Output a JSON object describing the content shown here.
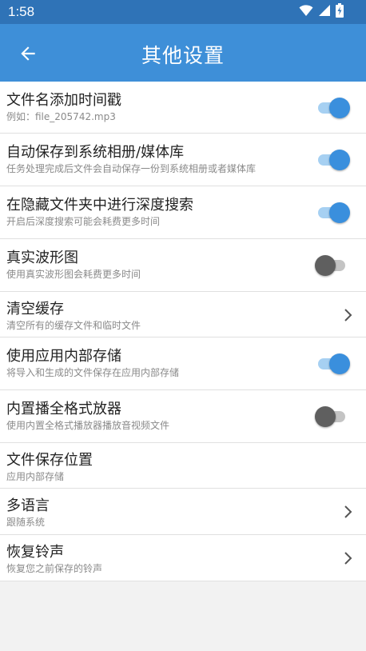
{
  "status_bar": {
    "time": "1:58",
    "icons": [
      "wifi-icon",
      "signal-icon",
      "battery-charging-icon"
    ]
  },
  "header": {
    "title": "其他设置",
    "back_icon": "arrow-left-icon"
  },
  "colors": {
    "header": "#3e8fd8",
    "status_bar": "#2f73b7",
    "toggle_on": "#3a8fdd",
    "toggle_off": "#5f5f5f"
  },
  "settings": [
    {
      "title": "文件名添加时间戳",
      "subtitle": "例如：file_205742.mp3",
      "control": "toggle",
      "on": true
    },
    {
      "title": "自动保存到系统相册/媒体库",
      "subtitle": "任务处理完成后文件会自动保存一份到系统相册或者媒体库",
      "control": "toggle",
      "on": true
    },
    {
      "title": "在隐藏文件夹中进行深度搜索",
      "subtitle": "开启后深度搜索可能会耗费更多时间",
      "control": "toggle",
      "on": true
    },
    {
      "title": "真实波形图",
      "subtitle": "使用真实波形图会耗费更多时间",
      "control": "toggle",
      "on": false
    },
    {
      "title": "清空缓存",
      "subtitle": "清空所有的缓存文件和临时文件",
      "control": "chevron"
    },
    {
      "title": "使用应用内部存储",
      "subtitle": "将导入和生成的文件保存在应用内部存储",
      "control": "toggle",
      "on": true
    },
    {
      "title": "内置播全格式放器",
      "subtitle": "使用内置全格式播放器播放音视频文件",
      "control": "toggle",
      "on": false
    },
    {
      "title": "文件保存位置",
      "subtitle": "应用内部存储",
      "control": "none"
    },
    {
      "title": "多语言",
      "subtitle": "跟随系统",
      "control": "chevron"
    },
    {
      "title": "恢复铃声",
      "subtitle": "恢复您之前保存的铃声",
      "control": "chevron"
    }
  ]
}
